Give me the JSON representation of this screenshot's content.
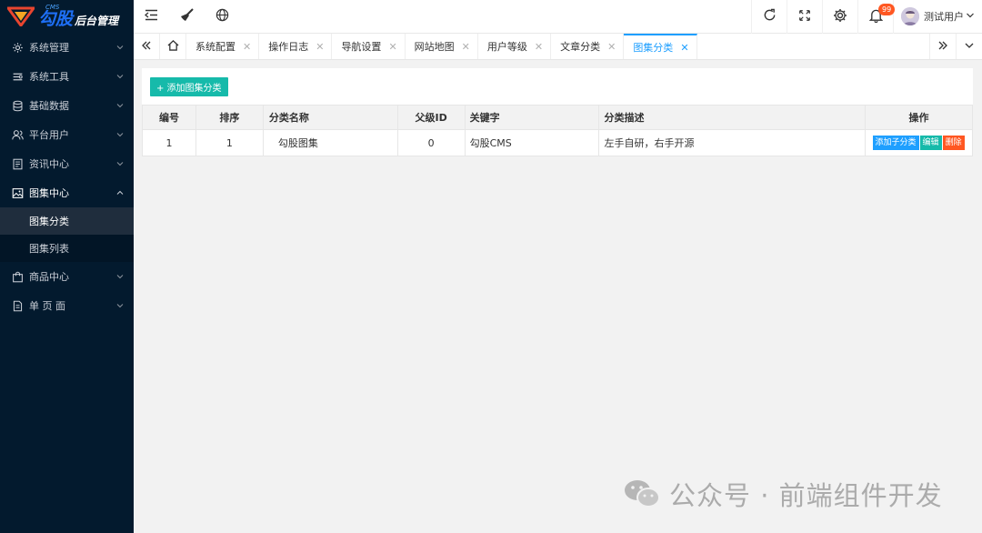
{
  "logo": {
    "brand": "勾股",
    "sub": "后台管理",
    "cms": "CMS"
  },
  "sidebar": {
    "items": [
      {
        "label": "系统管理",
        "icon": "gear-icon"
      },
      {
        "label": "系统工具",
        "icon": "tools-icon"
      },
      {
        "label": "基础数据",
        "icon": "database-icon"
      },
      {
        "label": "平台用户",
        "icon": "users-icon"
      },
      {
        "label": "资讯中心",
        "icon": "document-icon"
      },
      {
        "label": "图集中心",
        "icon": "image-icon",
        "open": true,
        "children": [
          {
            "label": "图集分类",
            "active": true
          },
          {
            "label": "图集列表"
          }
        ]
      },
      {
        "label": "商品中心",
        "icon": "bag-icon"
      },
      {
        "label": "单 页 面",
        "icon": "page-icon"
      }
    ]
  },
  "topbar": {
    "notification_count": "99",
    "username": "测试用户"
  },
  "tabs": [
    {
      "label": "系统配置"
    },
    {
      "label": "操作日志"
    },
    {
      "label": "导航设置"
    },
    {
      "label": "网站地图"
    },
    {
      "label": "用户等级"
    },
    {
      "label": "文章分类"
    },
    {
      "label": "图集分类",
      "active": true
    }
  ],
  "main": {
    "add_button": "+ 添加图集分类",
    "table": {
      "headers": [
        "编号",
        "排序",
        "分类名称",
        "父级ID",
        "关键字",
        "分类描述",
        "操作"
      ],
      "rows": [
        {
          "id": "1",
          "sort": "1",
          "name": "勾股图集",
          "parent_id": "0",
          "keyword": "勾股CMS",
          "desc": "左手自研，右手开源"
        }
      ],
      "actions": {
        "add_child": "添加子分类",
        "edit": "编辑",
        "delete": "删除"
      }
    }
  },
  "watermark": {
    "text": "公众号 · 前端组件开发"
  },
  "colors": {
    "sidebar_bg": "#031a2e",
    "accent": "#1e9fff",
    "teal": "#16baaa",
    "danger": "#ff5722"
  }
}
